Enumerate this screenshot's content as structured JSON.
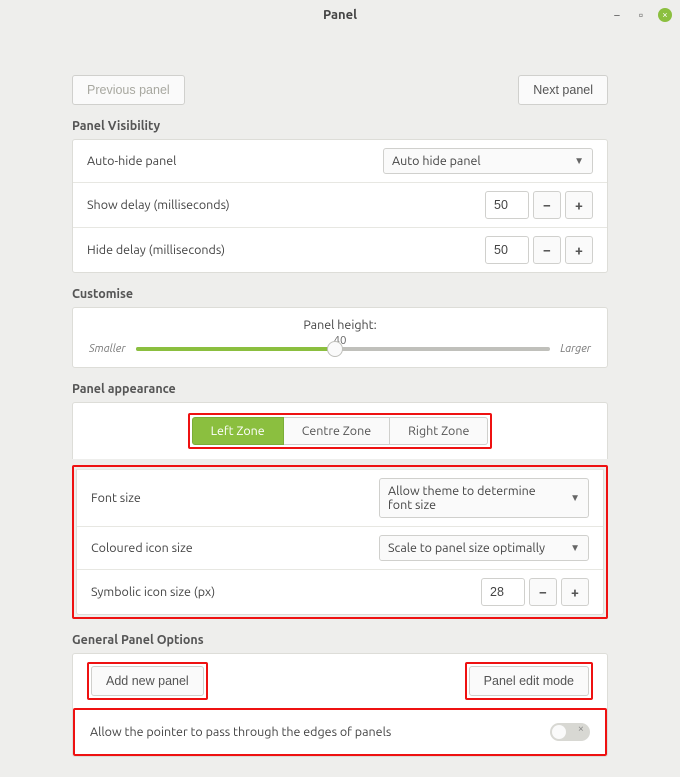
{
  "window": {
    "title": "Panel"
  },
  "nav": {
    "prev": "Previous panel",
    "next": "Next panel"
  },
  "visibility": {
    "section": "Panel Visibility",
    "autohide_label": "Auto-hide panel",
    "autohide_value": "Auto hide panel",
    "show_delay_label": "Show delay (milliseconds)",
    "show_delay_value": "50",
    "hide_delay_label": "Hide delay (milliseconds)",
    "hide_delay_value": "50"
  },
  "customise": {
    "section": "Customise",
    "height_label": "Panel height:",
    "height_value": "40",
    "smaller": "Smaller",
    "larger": "Larger"
  },
  "appearance": {
    "section": "Panel appearance",
    "tabs": {
      "left": "Left Zone",
      "center": "Centre Zone",
      "right": "Right Zone"
    },
    "font_size_label": "Font size",
    "font_size_value": "Allow theme to determine font size",
    "coloured_icon_label": "Coloured icon size",
    "coloured_icon_value": "Scale to panel size optimally",
    "symbolic_icon_label": "Symbolic icon size (px)",
    "symbolic_icon_value": "28"
  },
  "general": {
    "section": "General Panel Options",
    "add_panel": "Add new panel",
    "edit_mode": "Panel edit mode",
    "pointer_pass_label": "Allow the pointer to pass through the edges of panels"
  }
}
